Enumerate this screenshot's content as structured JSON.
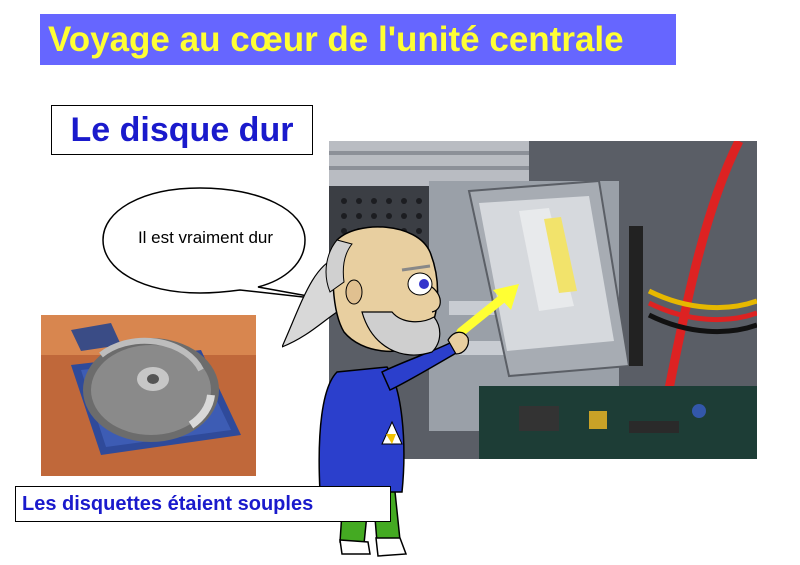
{
  "slide": {
    "title": "Voyage au cœur de l'unité centrale",
    "subtitle": "Le disque dur",
    "speech_bubble": "Il est vraiment dur",
    "caption": "Les disquettes étaient souples"
  },
  "colors": {
    "title_background": "#6666ff",
    "title_text": "#ffff33",
    "heading_text": "#1a1acc",
    "arrow": "#ffff33"
  },
  "illustrations": {
    "hard_drive_photo": "hard-drive-photo",
    "floppy_photo": "floppy-disk-photo",
    "character": "bearded-man-character"
  }
}
